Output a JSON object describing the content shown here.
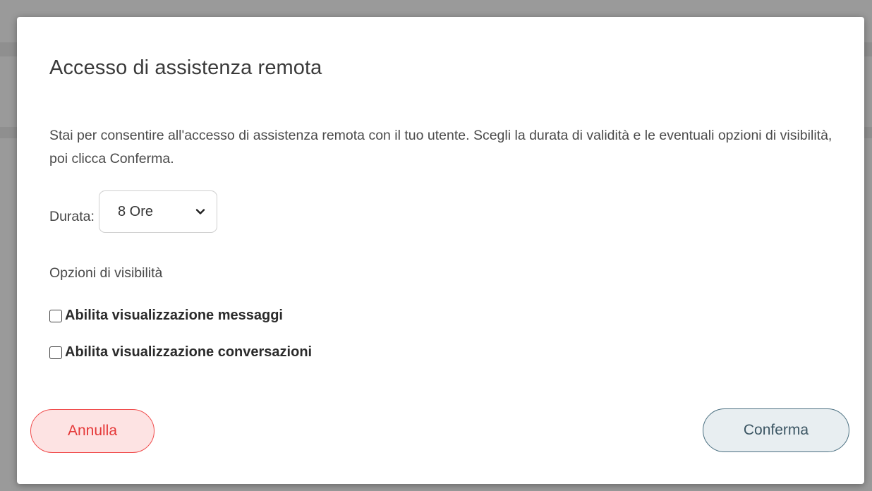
{
  "dialog": {
    "title": "Accesso di assistenza remota",
    "description": "Stai per consentire all'accesso di assistenza remota con il tuo utente. Scegli la durata di validità e le eventuali opzioni di visibilità, poi clicca Conferma.",
    "duration": {
      "label": "Durata:",
      "selected": "8 Ore",
      "icon": "chevron-down-icon"
    },
    "visibility": {
      "section_label": "Opzioni di visibilità",
      "options": [
        {
          "label": "Abilita visualizzazione messaggi",
          "checked": false
        },
        {
          "label": "Abilita visualizzazione conversazioni",
          "checked": false
        }
      ]
    },
    "buttons": {
      "cancel_label": "Annulla",
      "confirm_label": "Conferma"
    }
  },
  "colors": {
    "cancel_border": "#f04a4a",
    "cancel_bg": "#fde3e3",
    "cancel_text": "#e53939",
    "confirm_border": "#4a6f80",
    "confirm_bg": "#e8eef1",
    "confirm_text": "#3b5563",
    "backdrop": "#9a9a9a"
  }
}
